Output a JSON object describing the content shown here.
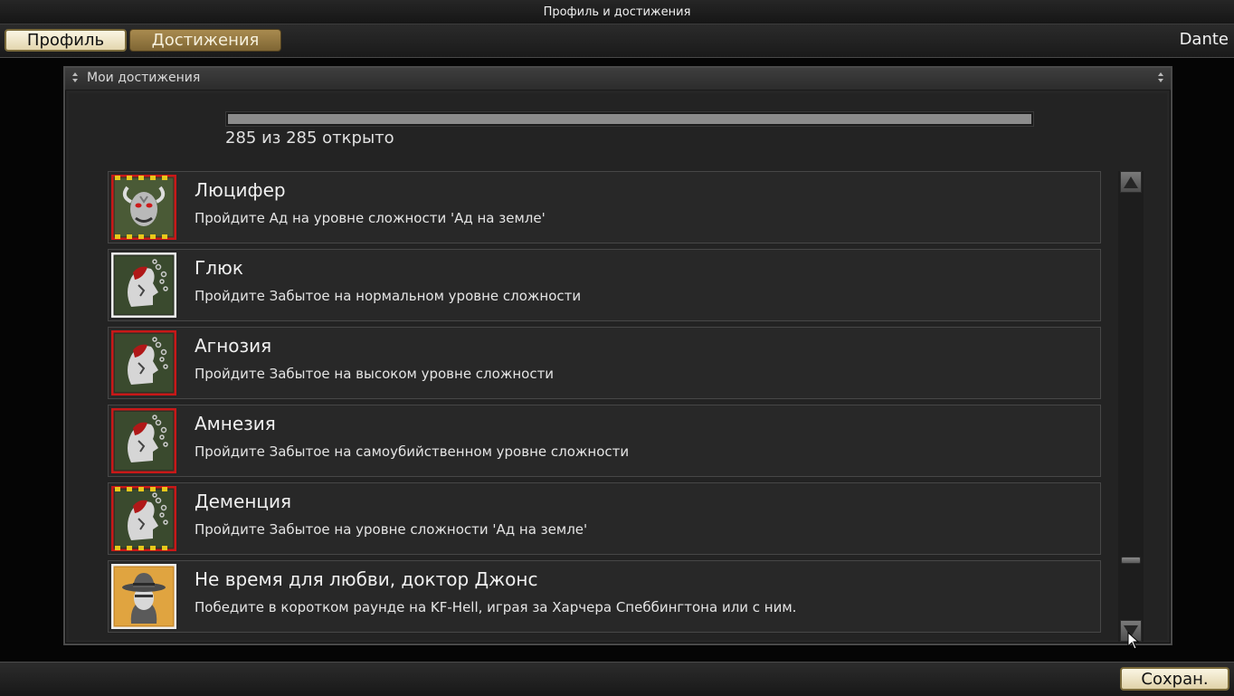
{
  "window": {
    "title": "Профиль и достижения"
  },
  "tabs": {
    "profile": "Профиль",
    "achievements": "Достижения"
  },
  "user": {
    "name": "Dante"
  },
  "panel": {
    "title": "Мои достижения",
    "progress": {
      "unlocked": 285,
      "total": 285,
      "fraction": 1.0,
      "text": "285 из 285 открыто"
    }
  },
  "achievements": [
    {
      "name": "Люцифер",
      "description": "Пройдите Ад на уровне сложности 'Ад на земле'",
      "icon": "demon-face-icon",
      "frame": "hazard"
    },
    {
      "name": "Глюк",
      "description": "Пройдите Забытое на нормальном уровне сложности",
      "icon": "fractured-head-icon",
      "frame": "white"
    },
    {
      "name": "Агнозия",
      "description": "Пройдите Забытое на высоком уровне сложности",
      "icon": "fractured-head-icon",
      "frame": "red"
    },
    {
      "name": "Амнезия",
      "description": "Пройдите Забытое на самоубийственном уровне сложности",
      "icon": "fractured-head-icon",
      "frame": "red"
    },
    {
      "name": "Деменция",
      "description": "Пройдите Забытое на уровне сложности 'Ад на земле'",
      "icon": "fractured-head-icon",
      "frame": "hazard"
    },
    {
      "name": "Не время для любви, доктор Джонс",
      "description": "Победите в коротком раунде на KF-Hell, играя за Харчера Спеббингтона или с ним.",
      "icon": "adventurer-fedora-icon",
      "frame": "white"
    }
  ],
  "scrollbar": {
    "position": 0.87
  },
  "footer": {
    "save_label": "Сохран."
  },
  "colors": {
    "gold_active": "#e3d6ae",
    "gold_dark": "#8f7540",
    "hazard_yellow": "#e8c81a",
    "hazard_red": "#c81818"
  }
}
